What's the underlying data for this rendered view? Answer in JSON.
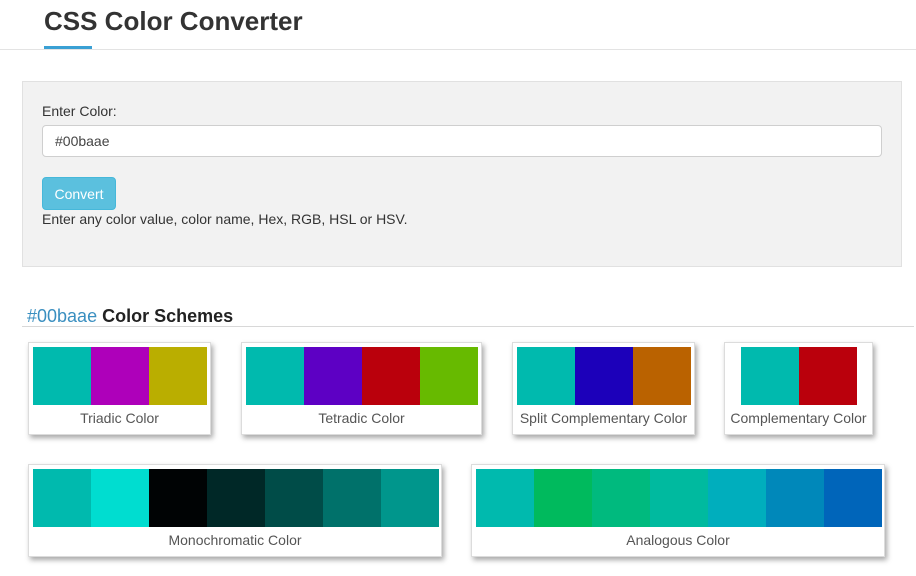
{
  "header": {
    "title": "CSS Color Converter"
  },
  "converter": {
    "label": "Enter Color:",
    "input_value": "#00baae",
    "button_label": "Convert",
    "hint": "Enter any color value, color name, Hex, RGB, HSL or HSV."
  },
  "schemes": {
    "heading_hex": "#00baae",
    "heading_text": " Color Schemes",
    "items": [
      {
        "label": "Triadic Color",
        "colors": [
          "#00baae",
          "#ae00ba",
          "#baae00"
        ]
      },
      {
        "label": "Tetradic Color",
        "colors": [
          "#00baae",
          "#5d00c4",
          "#ba000c",
          "#67ba00"
        ]
      },
      {
        "label": "Split Complementary Color",
        "colors": [
          "#00baae",
          "#1c00ba",
          "#ba6200"
        ]
      },
      {
        "label": "Complementary Color",
        "colors": [
          "#00baae",
          "#ba000c"
        ]
      },
      {
        "label": "Monochromatic Color",
        "colors": [
          "#00baae",
          "#00ddd0",
          "#000304",
          "#002827",
          "#004c48",
          "#00716a",
          "#00968c"
        ]
      },
      {
        "label": "Analogous Color",
        "colors": [
          "#00baae",
          "#00ba5d",
          "#00ba7e",
          "#00ba9f",
          "#00aebd",
          "#0088ba",
          "#0065ba"
        ]
      }
    ]
  }
}
